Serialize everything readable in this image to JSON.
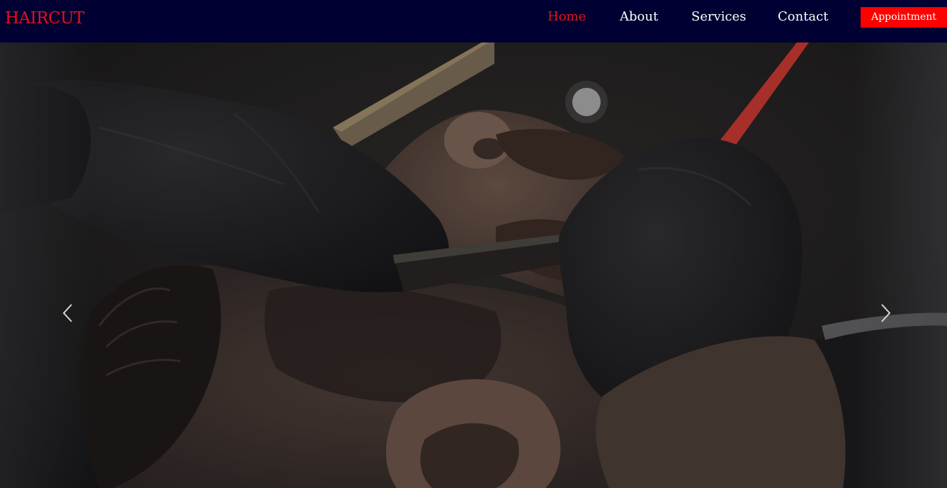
{
  "brand": {
    "name": "HAIRCUT",
    "color": "#e8101a"
  },
  "nav": {
    "background": "#000032",
    "items": [
      {
        "label": "Home",
        "active": true
      },
      {
        "label": "About",
        "active": false
      },
      {
        "label": "Services",
        "active": false
      },
      {
        "label": "Contact",
        "active": false
      }
    ],
    "cta_label": "Appointment",
    "cta_color": "#ff0000"
  },
  "hero": {
    "image": "barber-trimming-beard-photo",
    "prev_icon": "chevron-left-icon",
    "next_icon": "chevron-right-icon"
  }
}
